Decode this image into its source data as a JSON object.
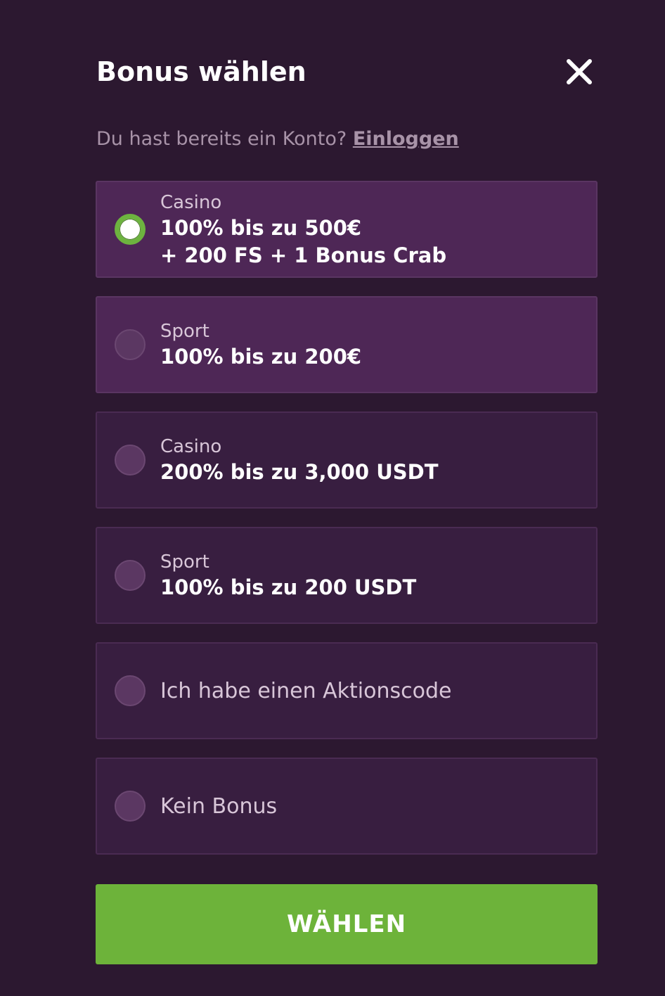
{
  "header": {
    "title": "Bonus wählen",
    "close_icon": "close-icon"
  },
  "login": {
    "prompt": "Du hast bereits ein Konto?",
    "link": "Einloggen"
  },
  "options": [
    {
      "category": "Casino",
      "offer_line1": "100% bis zu 500€",
      "offer_line2": "+ 200 FS + 1 Bonus Crab",
      "selected": true
    },
    {
      "category": "Sport",
      "offer_line1": "100% bis zu 200€",
      "selected": false
    },
    {
      "category": "Casino",
      "offer_line1": "200% bis zu 3,000 USDT",
      "selected": false
    },
    {
      "category": "Sport",
      "offer_line1": "100% bis zu 200 USDT",
      "selected": false
    },
    {
      "label": "Ich habe einen Aktionscode",
      "selected": false
    },
    {
      "label": "Kein Bonus",
      "selected": false
    }
  ],
  "submit": {
    "label": "WÄHLEN"
  },
  "colors": {
    "background": "#2c1830",
    "accent_green": "#6db33a",
    "card_light": "#4e2756",
    "card_dark": "#381e40"
  }
}
